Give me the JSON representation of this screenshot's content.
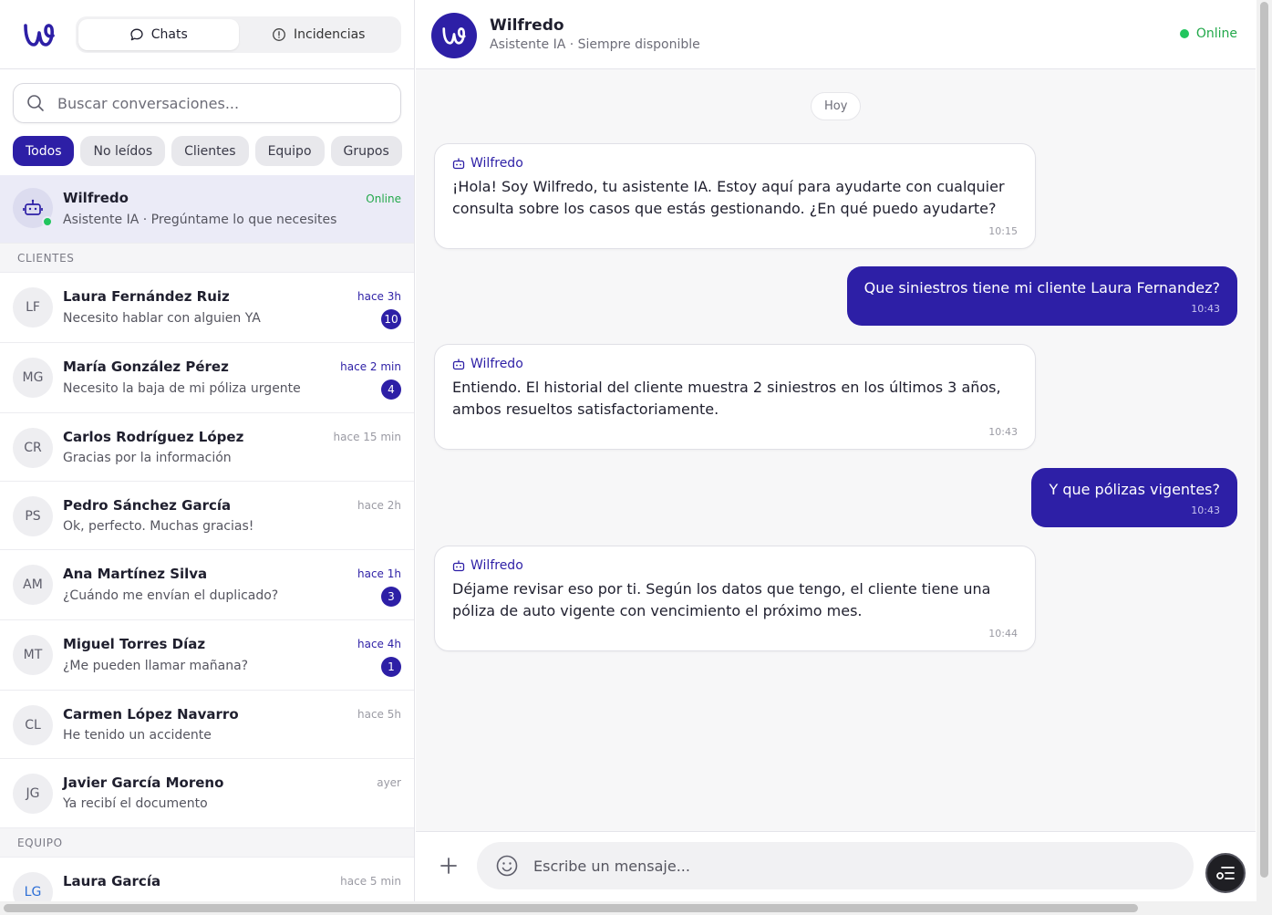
{
  "brand": {
    "accent": "#2d1fa6",
    "online": "#22c55e"
  },
  "tabs": [
    {
      "label": "Chats",
      "icon": "chat-bubble-icon",
      "active": true
    },
    {
      "label": "Incidencias",
      "icon": "alert-circle-icon",
      "active": false
    }
  ],
  "search": {
    "placeholder": "Buscar conversaciones..."
  },
  "filters": [
    "Todos",
    "No leídos",
    "Clientes",
    "Equipo",
    "Grupos"
  ],
  "pinned": {
    "name": "Wilfredo",
    "preview": "Asistente IA · Pregúntame lo que necesites",
    "status": "Online"
  },
  "sections": {
    "clients": "CLIENTES",
    "team": "EQUIPO"
  },
  "clients": [
    {
      "initials": "LF",
      "name": "Laura Fernández Ruiz",
      "preview": "Necesito hablar con alguien YA",
      "time": "hace 3h",
      "badge": "10"
    },
    {
      "initials": "MG",
      "name": "María González Pérez",
      "preview": "Necesito la baja de mi póliza urgente",
      "time": "hace 2 min",
      "badge": "4"
    },
    {
      "initials": "CR",
      "name": "Carlos Rodríguez López",
      "preview": "Gracias por la información",
      "time": "hace 15 min",
      "badge": ""
    },
    {
      "initials": "PS",
      "name": "Pedro Sánchez García",
      "preview": "Ok, perfecto. Muchas gracias!",
      "time": "hace 2h",
      "badge": ""
    },
    {
      "initials": "AM",
      "name": "Ana Martínez Silva",
      "preview": "¿Cuándo me envían el duplicado?",
      "time": "hace 1h",
      "badge": "3"
    },
    {
      "initials": "MT",
      "name": "Miguel Torres Díaz",
      "preview": "¿Me pueden llamar mañana?",
      "time": "hace 4h",
      "badge": "1"
    },
    {
      "initials": "CL",
      "name": "Carmen López Navarro",
      "preview": "He tenido un accidente",
      "time": "hace 5h",
      "badge": ""
    },
    {
      "initials": "JG",
      "name": "Javier García Moreno",
      "preview": "Ya recibí el documento",
      "time": "ayer",
      "badge": ""
    }
  ],
  "team": [
    {
      "initials": "LG",
      "name": "Laura García",
      "time": "hace 5 min"
    }
  ],
  "chat": {
    "name": "Wilfredo",
    "subtitle": "Asistente IA · Siempre disponible",
    "status": "Online",
    "day": "Hoy",
    "messages": [
      {
        "from": "bot",
        "sender": "Wilfredo",
        "text": "¡Hola! Soy Wilfredo, tu asistente IA. Estoy aquí para ayudarte con cualquier consulta sobre los casos que estás gestionando. ¿En qué puedo ayudarte?",
        "time": "10:15"
      },
      {
        "from": "me",
        "text": "Que siniestros tiene mi cliente Laura Fernandez?",
        "time": "10:43"
      },
      {
        "from": "bot",
        "sender": "Wilfredo",
        "text": "Entiendo. El historial del cliente muestra 2 siniestros en los últimos 3 años, ambos resueltos satisfactoriamente.",
        "time": "10:43"
      },
      {
        "from": "me",
        "text": "Y que pólizas vigentes?",
        "time": "10:43"
      },
      {
        "from": "bot",
        "sender": "Wilfredo",
        "text": "Déjame revisar eso por ti. Según los datos que tengo, el cliente tiene una póliza de auto vigente con vencimiento el próximo mes.",
        "time": "10:44"
      }
    ]
  },
  "composer": {
    "placeholder": "Escribe un mensaje..."
  }
}
